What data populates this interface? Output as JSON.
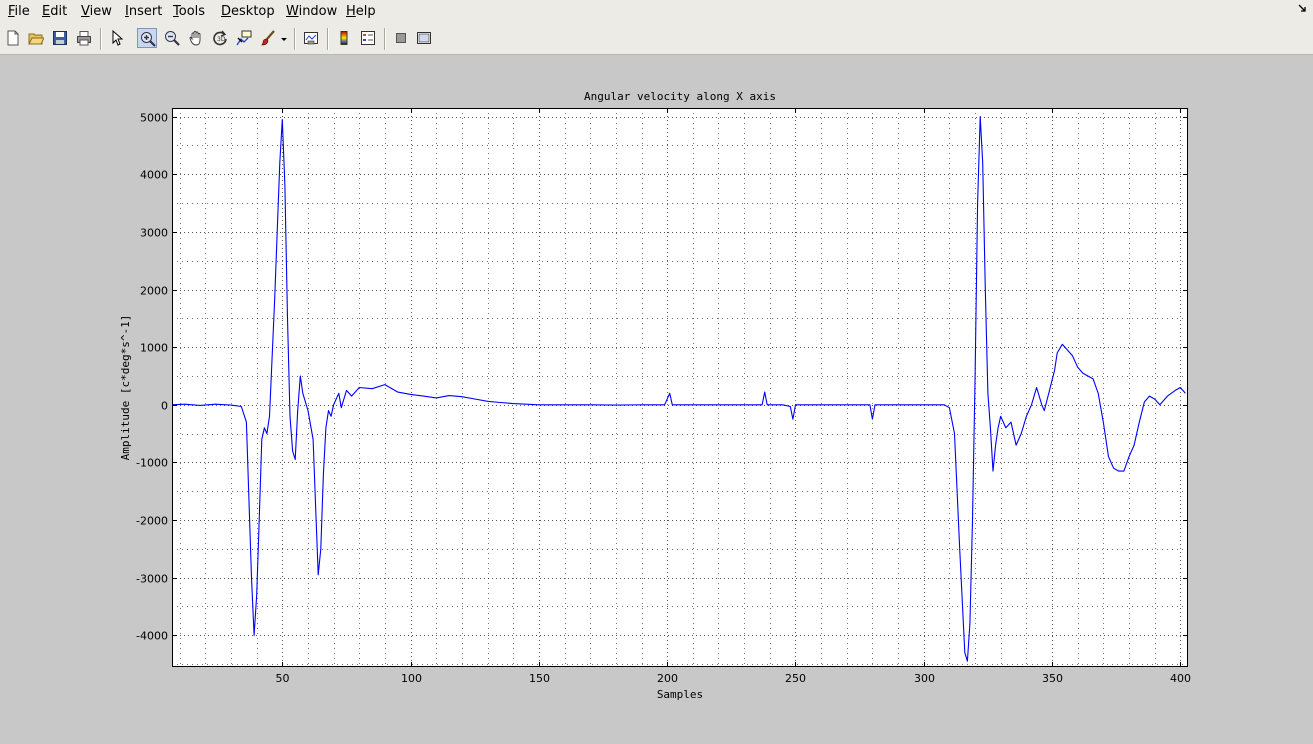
{
  "menu": {
    "items": [
      {
        "key": "file",
        "first": "F",
        "rest": "ile"
      },
      {
        "key": "edit",
        "first": "E",
        "rest": "dit"
      },
      {
        "key": "view",
        "first": "V",
        "rest": "iew"
      },
      {
        "key": "insert",
        "first": "I",
        "rest": "nsert"
      },
      {
        "key": "tools",
        "first": "T",
        "rest": "ools"
      },
      {
        "key": "desktop",
        "first": "D",
        "rest": "esktop"
      },
      {
        "key": "window",
        "first": "W",
        "rest": "indow"
      },
      {
        "key": "help",
        "first": "H",
        "rest": "elp"
      }
    ]
  },
  "toolbar": {
    "icons": [
      "new-figure-icon",
      "open-file-icon",
      "save-icon",
      "print-icon",
      "select-arrow-icon",
      "zoom-in-icon",
      "zoom-out-icon",
      "pan-hand-icon",
      "rotate-3d-icon",
      "data-cursor-icon",
      "brush-icon",
      "brush-dropdown-icon",
      "link-plot-icon",
      "colorbar-icon",
      "legend-icon",
      "hide-plot-tools-icon",
      "show-plot-tools-icon"
    ],
    "active": "zoom-in-icon"
  },
  "colors": {
    "line": "#0000ff",
    "axes_bg": "#ffffff",
    "figure_bg": "#c8c8c8",
    "menu_bg": "#ecebe6"
  },
  "chart_data": {
    "type": "line",
    "title": "Angular velocity along X axis",
    "xlabel": "Samples",
    "ylabel": "Amplitude [c*deg*s^-1]",
    "xlim": [
      7,
      403
    ],
    "ylim": [
      -4550,
      5150
    ],
    "xticks": [
      50,
      100,
      150,
      200,
      250,
      300,
      350,
      400
    ],
    "yticks": [
      5000,
      4000,
      3000,
      2000,
      1000,
      0,
      -1000,
      -2000,
      -3000,
      -4000
    ],
    "grid": true,
    "series": [
      {
        "color": "#0000ff",
        "points": [
          [
            7,
            0
          ],
          [
            12,
            10
          ],
          [
            18,
            -10
          ],
          [
            24,
            10
          ],
          [
            30,
            -5
          ],
          [
            34,
            -30
          ],
          [
            36,
            -300
          ],
          [
            38,
            -3000
          ],
          [
            39,
            -4000
          ],
          [
            40,
            -3300
          ],
          [
            41,
            -2000
          ],
          [
            42,
            -600
          ],
          [
            43,
            -400
          ],
          [
            44,
            -500
          ],
          [
            45,
            -200
          ],
          [
            47,
            1800
          ],
          [
            49,
            4200
          ],
          [
            50,
            4950
          ],
          [
            51,
            3800
          ],
          [
            52,
            1500
          ],
          [
            53,
            -200
          ],
          [
            54,
            -800
          ],
          [
            55,
            -950
          ],
          [
            56,
            -100
          ],
          [
            57,
            500
          ],
          [
            58,
            200
          ],
          [
            60,
            -100
          ],
          [
            62,
            -600
          ],
          [
            63,
            -1800
          ],
          [
            64,
            -2950
          ],
          [
            65,
            -2500
          ],
          [
            66,
            -1200
          ],
          [
            67,
            -400
          ],
          [
            68,
            -100
          ],
          [
            69,
            -200
          ],
          [
            70,
            0
          ],
          [
            71,
            100
          ],
          [
            72,
            200
          ],
          [
            73,
            -50
          ],
          [
            75,
            250
          ],
          [
            77,
            150
          ],
          [
            80,
            300
          ],
          [
            85,
            280
          ],
          [
            90,
            350
          ],
          [
            95,
            220
          ],
          [
            100,
            180
          ],
          [
            105,
            150
          ],
          [
            110,
            120
          ],
          [
            115,
            160
          ],
          [
            120,
            140
          ],
          [
            125,
            100
          ],
          [
            130,
            60
          ],
          [
            135,
            40
          ],
          [
            140,
            20
          ],
          [
            150,
            0
          ],
          [
            160,
            0
          ],
          [
            170,
            0
          ],
          [
            180,
            -5
          ],
          [
            190,
            0
          ],
          [
            199,
            0
          ],
          [
            201,
            200
          ],
          [
            202,
            0
          ],
          [
            210,
            0
          ],
          [
            220,
            0
          ],
          [
            230,
            0
          ],
          [
            237,
            0
          ],
          [
            238,
            220
          ],
          [
            239,
            0
          ],
          [
            245,
            0
          ],
          [
            248,
            -30
          ],
          [
            249,
            -250
          ],
          [
            250,
            0
          ],
          [
            260,
            0
          ],
          [
            270,
            0
          ],
          [
            279,
            0
          ],
          [
            280,
            -250
          ],
          [
            281,
            0
          ],
          [
            290,
            0
          ],
          [
            300,
            0
          ],
          [
            308,
            0
          ],
          [
            310,
            -50
          ],
          [
            312,
            -500
          ],
          [
            314,
            -2500
          ],
          [
            316,
            -4300
          ],
          [
            317,
            -4450
          ],
          [
            318,
            -3800
          ],
          [
            319,
            -2000
          ],
          [
            320,
            500
          ],
          [
            321,
            3500
          ],
          [
            322,
            5000
          ],
          [
            323,
            4200
          ],
          [
            324,
            2000
          ],
          [
            325,
            200
          ],
          [
            326,
            -400
          ],
          [
            327,
            -1150
          ],
          [
            328,
            -700
          ],
          [
            329,
            -400
          ],
          [
            330,
            -200
          ],
          [
            331,
            -300
          ],
          [
            332,
            -400
          ],
          [
            334,
            -300
          ],
          [
            336,
            -700
          ],
          [
            338,
            -500
          ],
          [
            340,
            -200
          ],
          [
            342,
            0
          ],
          [
            344,
            300
          ],
          [
            346,
            0
          ],
          [
            347,
            -100
          ],
          [
            349,
            250
          ],
          [
            351,
            600
          ],
          [
            352,
            900
          ],
          [
            354,
            1050
          ],
          [
            356,
            950
          ],
          [
            358,
            850
          ],
          [
            360,
            650
          ],
          [
            362,
            550
          ],
          [
            364,
            500
          ],
          [
            366,
            450
          ],
          [
            368,
            200
          ],
          [
            370,
            -300
          ],
          [
            372,
            -900
          ],
          [
            374,
            -1100
          ],
          [
            376,
            -1150
          ],
          [
            378,
            -1150
          ],
          [
            380,
            -900
          ],
          [
            382,
            -700
          ],
          [
            384,
            -300
          ],
          [
            386,
            50
          ],
          [
            388,
            150
          ],
          [
            390,
            100
          ],
          [
            392,
            0
          ],
          [
            395,
            150
          ],
          [
            398,
            250
          ],
          [
            400,
            300
          ],
          [
            402,
            200
          ]
        ]
      }
    ]
  }
}
